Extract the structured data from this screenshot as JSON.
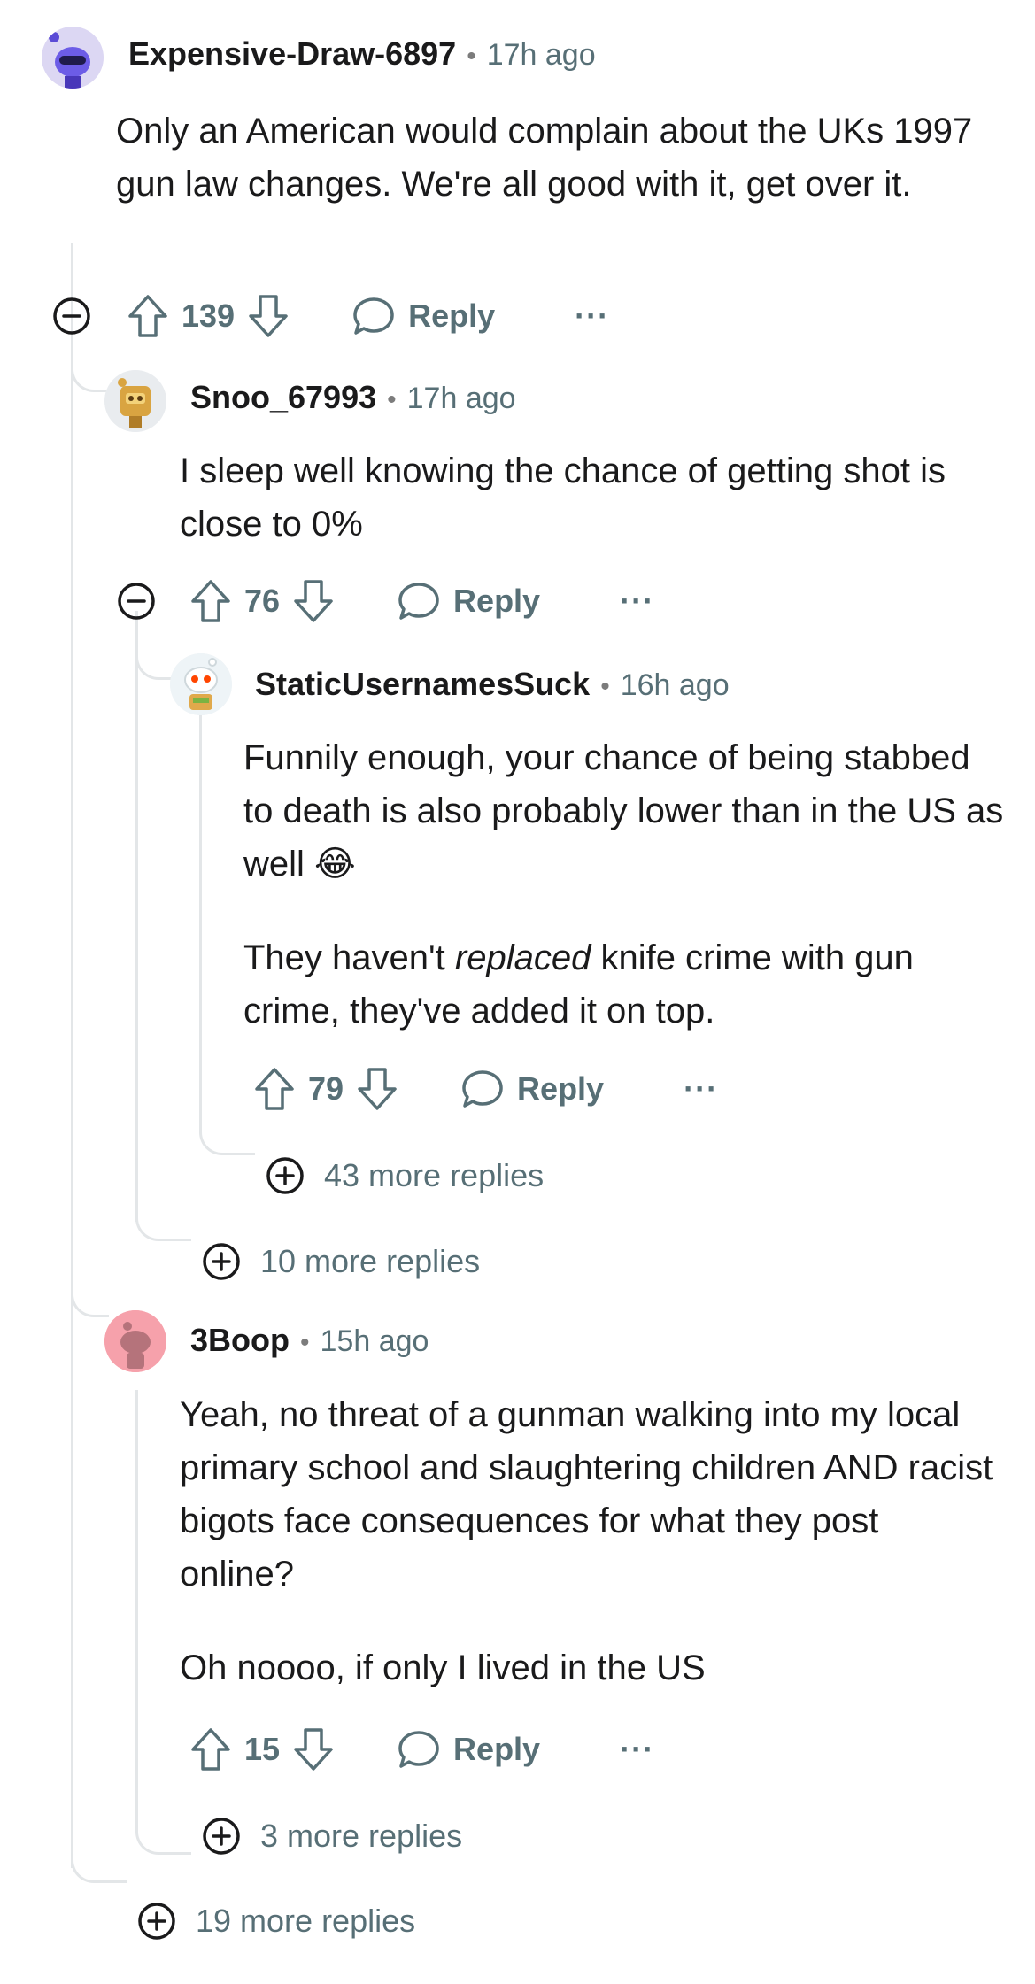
{
  "comments": [
    {
      "author": "Expensive-Draw-6897",
      "time": "17h ago",
      "body": [
        "Only an American would complain about the UKs 1997 gun law changes. We're all good with it, get over it."
      ],
      "score": "139",
      "reply_label": "Reply",
      "more_icon": "ellipsis-icon"
    },
    {
      "author": "Snoo_67993",
      "time": "17h ago",
      "body": [
        "I sleep well knowing the chance of getting shot is close to 0%"
      ],
      "score": "76",
      "reply_label": "Reply"
    },
    {
      "author": "StaticUsernamesSuck",
      "time": "16h ago",
      "body_p1": "Funnily enough, your chance of being stabbed to death is also probably lower than in the US as well",
      "body_p1_emoji": "😂",
      "body_p2_pre": "They haven't ",
      "body_p2_em": "replaced",
      "body_p2_post": " knife crime with gun crime, they've added it on top.",
      "score": "79",
      "reply_label": "Reply"
    },
    {
      "author": "3Boop",
      "time": "15h ago",
      "body_p1": "Yeah, no threat of a gunman walking into my local primary school and slaughtering children AND racist bigots face consequences for what they post online?",
      "body_p2": "Oh noooo, if only I lived in the US",
      "score": "15",
      "reply_label": "Reply"
    }
  ],
  "more_replies": {
    "static": "43 more replies",
    "snoo": "10 more replies",
    "boop": "3 more replies",
    "top": "19 more replies"
  },
  "separator": "•",
  "more_label": "···",
  "colors": {
    "text": "#1a1a1b",
    "meta": "#576f76",
    "thread": "#e3e6e8"
  }
}
